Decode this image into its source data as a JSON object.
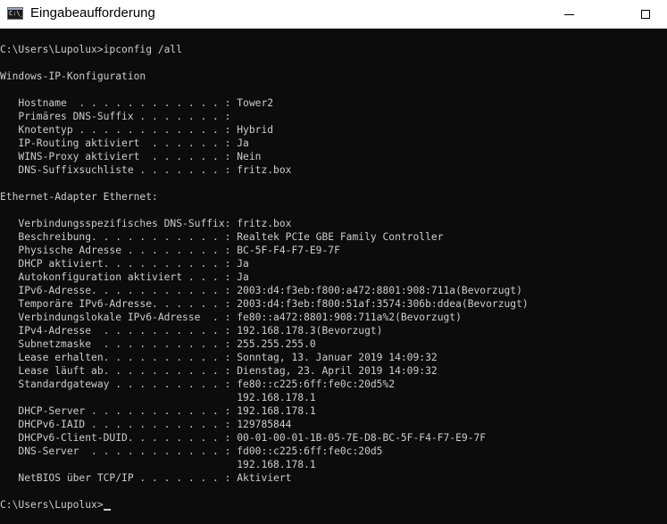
{
  "window": {
    "title": "Eingabeaufforderung",
    "icon": "cmd-icon",
    "icon_text": "C:\\_"
  },
  "console": {
    "lines": [
      "C:\\Users\\Lupolux>ipconfig /all",
      "",
      "Windows-IP-Konfiguration",
      "",
      "   Hostname  . . . . . . . . . . . . : Tower2",
      "   Primäres DNS-Suffix . . . . . . . :",
      "   Knotentyp . . . . . . . . . . . . : Hybrid",
      "   IP-Routing aktiviert  . . . . . . : Ja",
      "   WINS-Proxy aktiviert  . . . . . . : Nein",
      "   DNS-Suffixsuchliste . . . . . . . : fritz.box",
      "",
      "Ethernet-Adapter Ethernet:",
      "",
      "   Verbindungsspezifisches DNS-Suffix: fritz.box",
      "   Beschreibung. . . . . . . . . . . : Realtek PCIe GBE Family Controller",
      "   Physische Adresse . . . . . . . . : BC-5F-F4-F7-E9-7F",
      "   DHCP aktiviert. . . . . . . . . . : Ja",
      "   Autokonfiguration aktiviert . . . : Ja",
      "   IPv6-Adresse. . . . . . . . . . . : 2003:d4:f3eb:f800:a472:8801:908:711a(Bevorzugt)",
      "   Temporäre IPv6-Adresse. . . . . . : 2003:d4:f3eb:f800:51af:3574:306b:ddea(Bevorzugt)",
      "   Verbindungslokale IPv6-Adresse  . : fe80::a472:8801:908:711a%2(Bevorzugt)",
      "   IPv4-Adresse  . . . . . . . . . . : 192.168.178.3(Bevorzugt)",
      "   Subnetzmaske  . . . . . . . . . . : 255.255.255.0",
      "   Lease erhalten. . . . . . . . . . : Sonntag, 13. Januar 2019 14:09:32",
      "   Lease läuft ab. . . . . . . . . . : Dienstag, 23. April 2019 14:09:32",
      "   Standardgateway . . . . . . . . . : fe80::c225:6ff:fe0c:20d5%2",
      "                                       192.168.178.1",
      "   DHCP-Server . . . . . . . . . . . : 192.168.178.1",
      "   DHCPv6-IAID . . . . . . . . . . . : 129785844",
      "   DHCPv6-Client-DUID. . . . . . . . : 00-01-00-01-1B-05-7E-D8-BC-5F-F4-F7-E9-7F",
      "   DNS-Server  . . . . . . . . . . . : fd00::c225:6ff:fe0c:20d5",
      "                                       192.168.178.1",
      "   NetBIOS über TCP/IP . . . . . . . : Aktiviert",
      "",
      "C:\\Users\\Lupolux>"
    ]
  }
}
